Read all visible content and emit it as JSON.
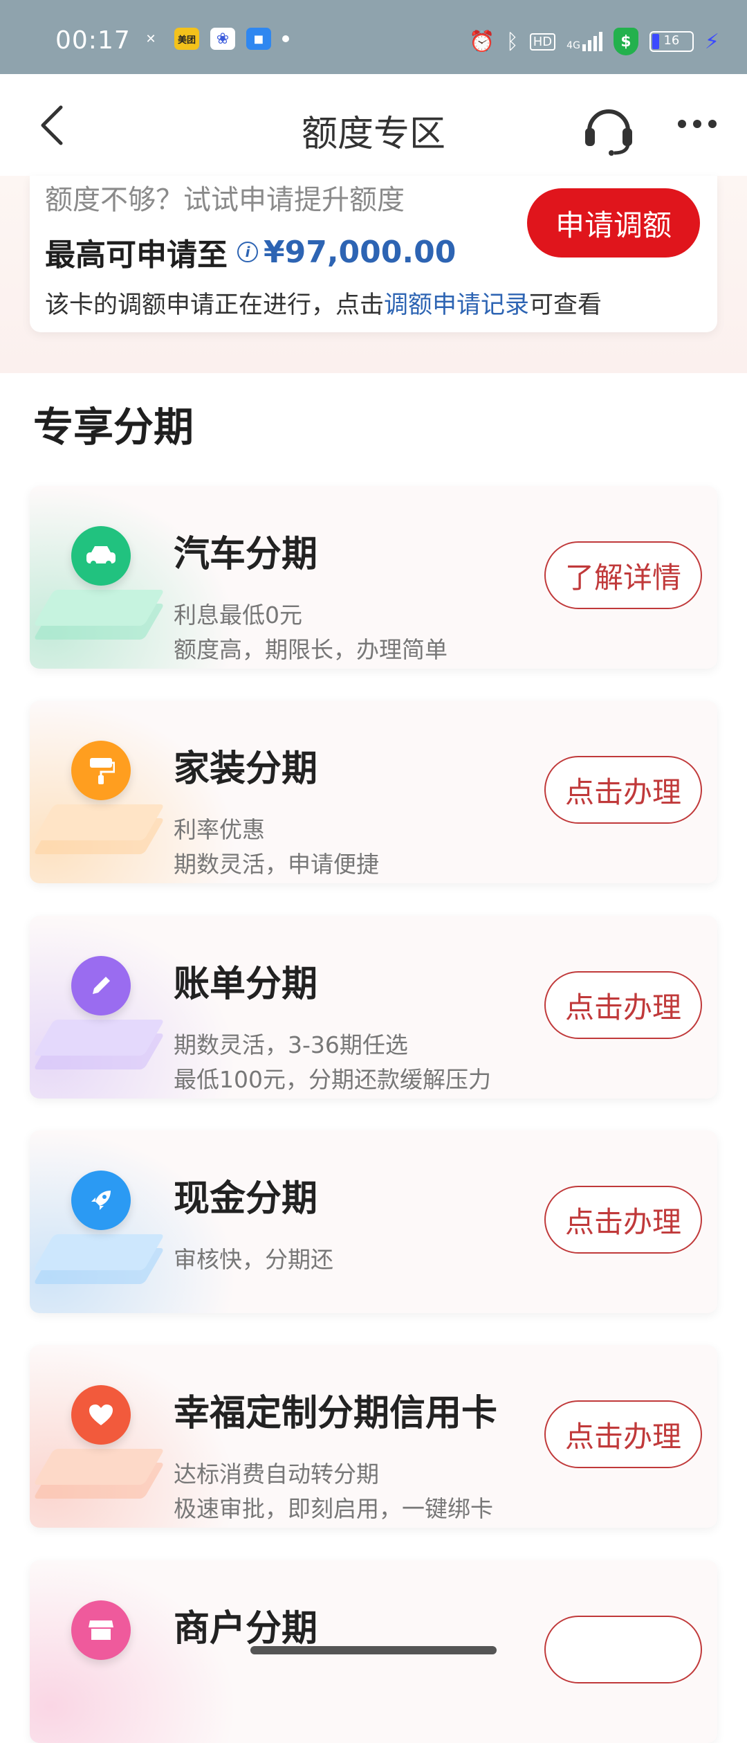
{
  "status_bar": {
    "time": "00:17",
    "meituan_label": "美团",
    "battery_level": "16",
    "network": "4G",
    "hd_label": "HD"
  },
  "nav": {
    "title": "额度专区"
  },
  "limit_card": {
    "hint": "额度不够？试试申请提升额度",
    "max_label": "最高可申请至",
    "max_amount": "¥97,000.00",
    "status_prefix": "该卡的调额申请正在进行，点击",
    "status_link": "调额申请记录",
    "status_suffix": "可查看",
    "apply_button": "申请调额"
  },
  "section": {
    "title": "专享分期"
  },
  "cards": [
    {
      "title": "汽车分期",
      "line1": "利息最低0元",
      "line2": "额度高，期限长，办理简单",
      "button": "了解详情",
      "icon": "car-icon",
      "color": "#21c27f"
    },
    {
      "title": "家装分期",
      "line1": "利率优惠",
      "line2": "期数灵活，申请便捷",
      "button": "点击办理",
      "icon": "paint-roller-icon",
      "color": "#ff9e1f"
    },
    {
      "title": "账单分期",
      "line1": "期数灵活，3-36期任选",
      "line2": "最低100元，分期还款缓解压力",
      "button": "点击办理",
      "icon": "pencil-icon",
      "color": "#9a6cf0"
    },
    {
      "title": "现金分期",
      "line1": "审核快，分期还",
      "line2": "",
      "button": "点击办理",
      "icon": "rocket-icon",
      "color": "#2b9af3"
    },
    {
      "title": "幸福定制分期信用卡",
      "line1": "达标消费自动转分期",
      "line2": "极速审批，即刻启用，一键绑卡",
      "button": "点击办理",
      "icon": "heart-icon",
      "color": "#f25a3c"
    },
    {
      "title": "商户分期",
      "line1": "",
      "line2": "",
      "button": "",
      "icon": "shop-icon",
      "color": "#ef5a9c"
    }
  ]
}
